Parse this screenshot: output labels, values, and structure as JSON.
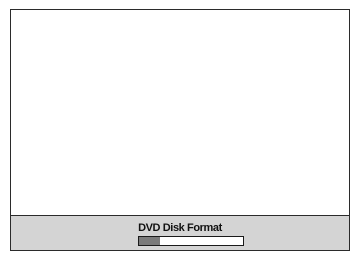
{
  "status": {
    "label": "DVD Disk Format",
    "progress_fraction": 0.2
  },
  "colors": {
    "status_bar_bg": "#d4d4d4",
    "progress_fill": "#7a7a7a",
    "border": "#2b2b2b"
  }
}
